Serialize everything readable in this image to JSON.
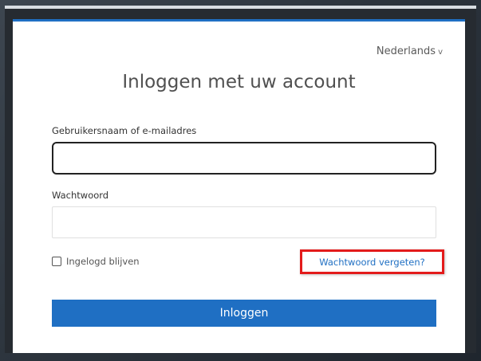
{
  "language": {
    "label": "Nederlands",
    "chevron": "v"
  },
  "title": "Inloggen met uw account",
  "username": {
    "label": "Gebruikersnaam of e-mailadres",
    "value": ""
  },
  "password": {
    "label": "Wachtwoord",
    "value": ""
  },
  "remember": {
    "label": "Ingelogd blijven",
    "checked": false
  },
  "forgot_link": "Wachtwoord vergeten?",
  "submit_label": "Inloggen",
  "colors": {
    "accent": "#1f6fc3",
    "highlight": "#e31b1b",
    "background": "#262b31"
  }
}
